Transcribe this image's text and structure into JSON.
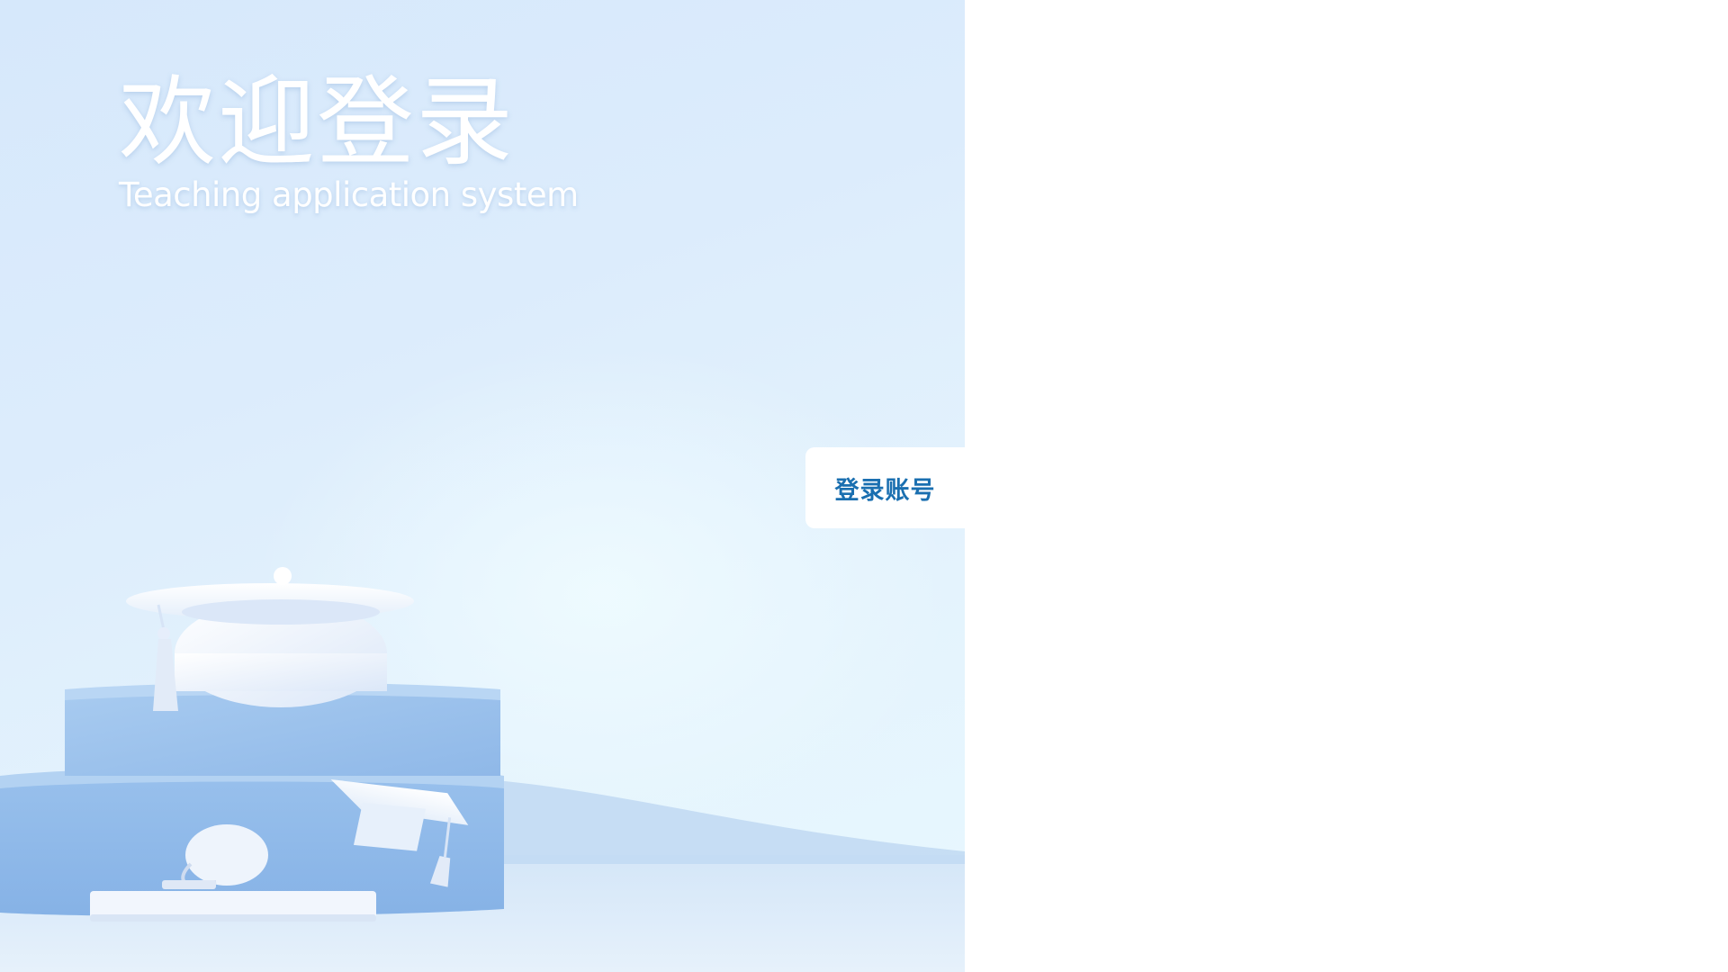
{
  "hero": {
    "title": "欢迎登录",
    "subtitle": "Teaching application system",
    "image_description": "graduation-caps-on-blue-podium"
  },
  "login": {
    "tab_label": "登录账号"
  },
  "colors": {
    "accent": "#1a6fb0",
    "hero_background": "#d6e8fb",
    "podium": "#9cc2ec"
  }
}
